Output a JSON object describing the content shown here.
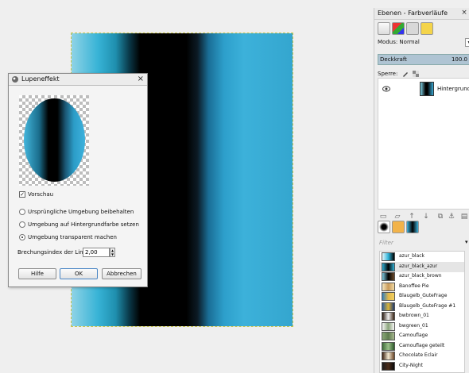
{
  "dock": {
    "title": "Ebenen - Farbverläufe",
    "close_glyph": "×",
    "mode_label": "Modus: Normal",
    "opacity_label": "Deckkraft",
    "opacity_value": "100.0",
    "lock_label": "Sperre:",
    "layer_name": "Hintergrund",
    "filter_placeholder": "Filter",
    "gradients": [
      {
        "name": "azur_black",
        "c": [
          "#e8f8fc",
          "#2fb3d8",
          "#000000"
        ]
      },
      {
        "name": "azur_black_azur",
        "c": [
          "#2fb3d8",
          "#000000",
          "#2fb3d8"
        ],
        "selected": true
      },
      {
        "name": "azur_black_brown",
        "c": [
          "#7fd0e6",
          "#000000",
          "#6b4a2a"
        ]
      },
      {
        "name": "Banoffee Pie",
        "c": [
          "#f6e7c2",
          "#c89a59",
          "#f0d9a4"
        ]
      },
      {
        "name": "Blaugelb_GuteFrage",
        "c": [
          "#2f7fbf",
          "#e2b84a",
          "#f2d060"
        ]
      },
      {
        "name": "Blaugelb_GuteFrage #1",
        "c": [
          "#2d5f9f",
          "#d9b339",
          "#1f3a70"
        ]
      },
      {
        "name": "bwbrown_01",
        "c": [
          "#2a1a10",
          "#f2f2f2",
          "#3a2414"
        ]
      },
      {
        "name": "bwgreen_01",
        "c": [
          "#f7f7f7",
          "#8aa37a",
          "#f7f7f7"
        ]
      },
      {
        "name": "Camouflage",
        "c": [
          "#8aa878",
          "#5e7c4e",
          "#a7b88f"
        ]
      },
      {
        "name": "Camouflage geteilt",
        "c": [
          "#3f6b3a",
          "#9bc08a",
          "#2e5a2b"
        ]
      },
      {
        "name": "Chocolate Eclair",
        "c": [
          "#3b2212",
          "#f4ead2",
          "#6a4528"
        ]
      },
      {
        "name": "City-Night",
        "c": [
          "#1d1d1d",
          "#4a2c1a",
          "#0b0b0b"
        ]
      }
    ]
  },
  "dialog": {
    "title": "Lupeneffekt",
    "close_glyph": "×",
    "preview_label": "Vorschau",
    "preview_checked": true,
    "options": [
      {
        "label": "Ursprüngliche Umgebung beibehalten",
        "selected": false
      },
      {
        "label": "Umgebung auf Hintergrundfarbe setzen",
        "selected": false
      },
      {
        "label": "Umgebung transparent machen",
        "selected": true
      }
    ],
    "refraction_label": "Brechungsindex der Linse:",
    "refraction_value": "2,00",
    "buttons": {
      "help": "Hilfe",
      "ok": "OK",
      "cancel": "Abbrechen"
    }
  },
  "colors": {
    "accent_blue": "#3cb1da",
    "selection_row": "#e5e5e5",
    "opacity_bar": "#afc4d3"
  }
}
